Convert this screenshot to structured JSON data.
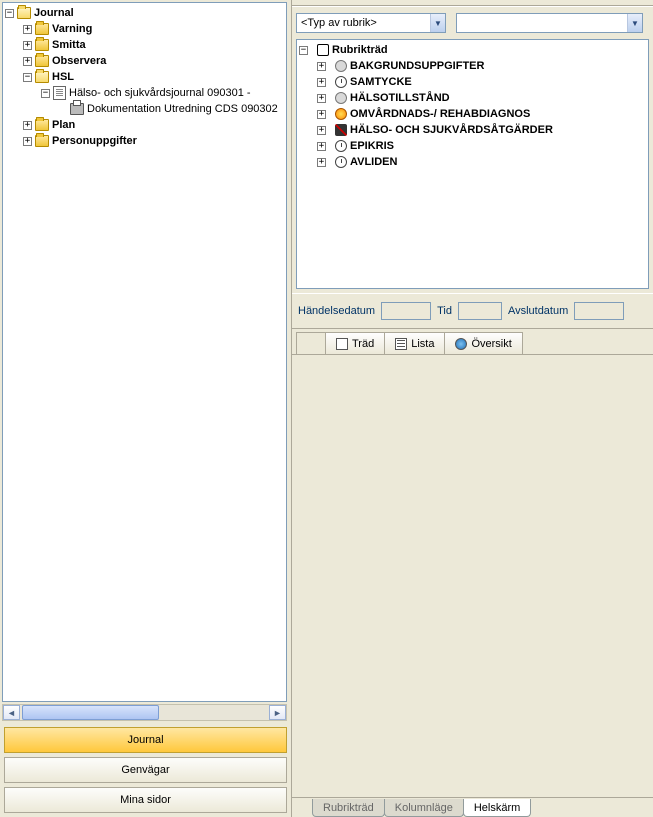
{
  "left_tree": {
    "root": "Journal",
    "varning": "Varning",
    "smitta": "Smitta",
    "observera": "Observera",
    "hsl": "HSL",
    "hsl_doc1": "Hälso- och sjukvårdsjournal 090301 -",
    "hsl_doc2": "Dokumentation Utredning CDS 090302",
    "plan": "Plan",
    "personuppgifter": "Personuppgifter"
  },
  "nav": {
    "journal": "Journal",
    "genvagar": "Genvägar",
    "minasidor": "Mina sidor"
  },
  "combo_type": "<Typ av rubrik>",
  "rubrik": {
    "root": "Rubrikträd",
    "items": [
      "BAKGRUNDSUPPGIFTER",
      "SAMTYCKE",
      "HÄLSOTILLSTÅND",
      "OMVÅRDNADS-/ REHABDIAGNOS",
      "HÄLSO- OCH SJUKVÅRDSÅTGÄRDER",
      "EPIKRIS",
      "AVLIDEN"
    ]
  },
  "fields": {
    "handelsedatum": "Händelsedatum",
    "tid": "Tid",
    "avslutdatum": "Avslutdatum"
  },
  "viewtabs": {
    "trad": "Träd",
    "lista": "Lista",
    "oversikt": "Översikt"
  },
  "bottomtabs": {
    "rubriktrad": "Rubrikträd",
    "kolumnlage": "Kolumnläge",
    "helskarm": "Helskärm"
  }
}
